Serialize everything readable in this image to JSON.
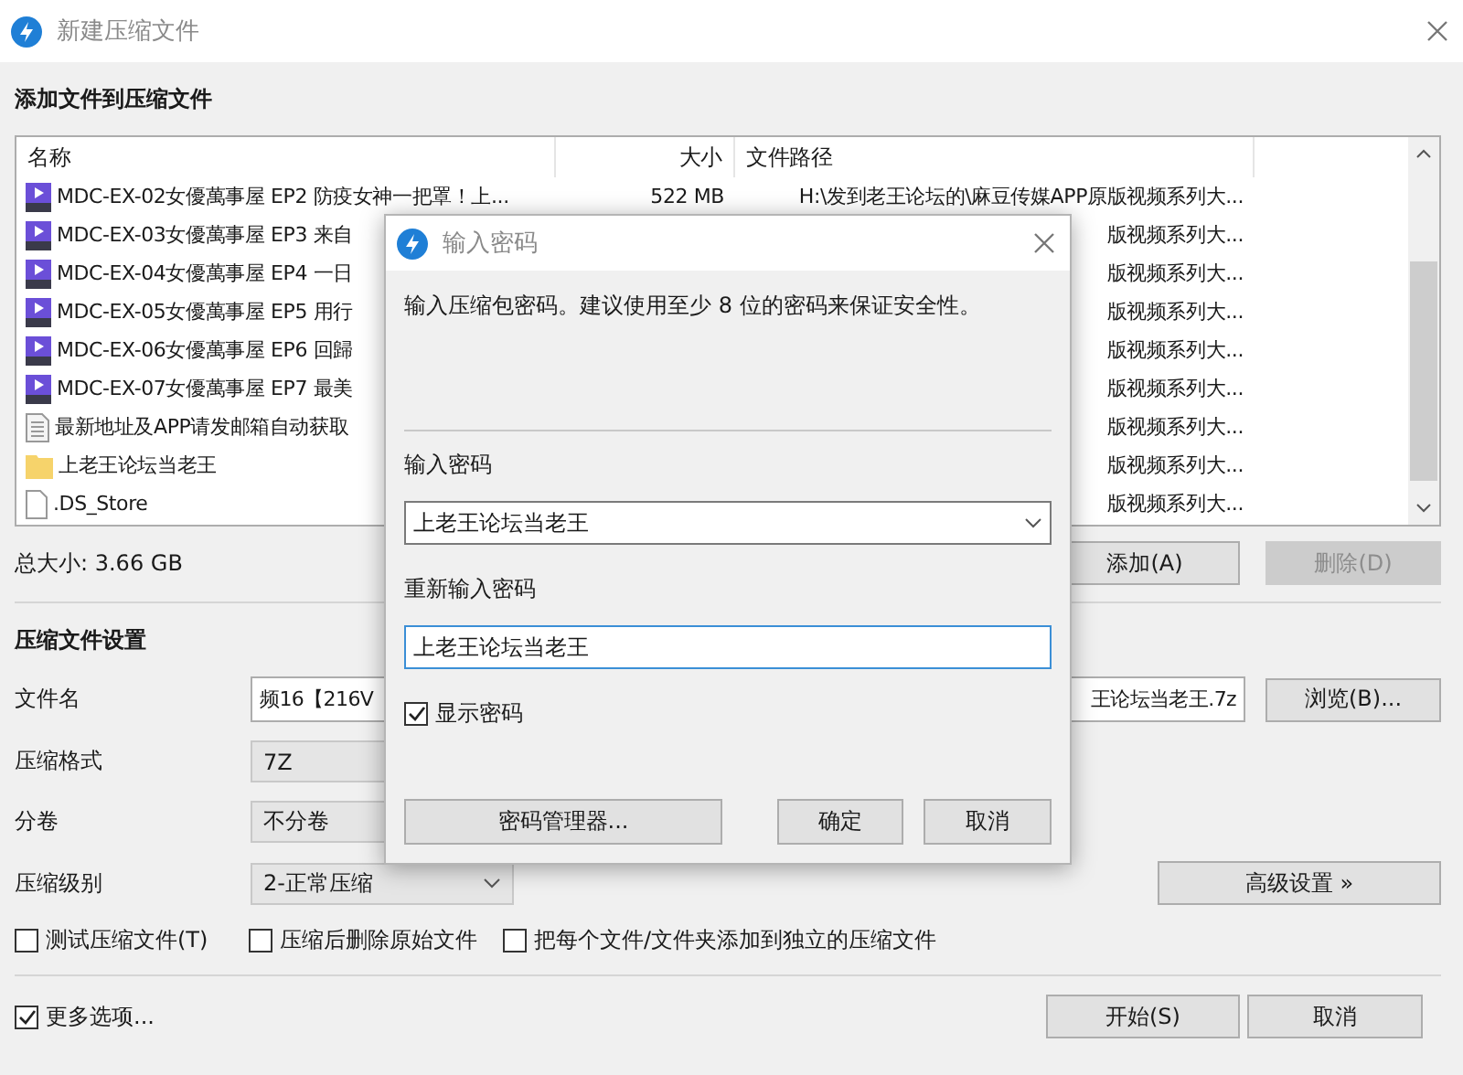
{
  "window": {
    "title": "新建压缩文件"
  },
  "files": {
    "heading": "添加文件到压缩文件",
    "columns": [
      "名称",
      "大小",
      "文件路径"
    ],
    "rows": [
      {
        "kind": "video",
        "name": "MDC-EX-02女優萬事屋 EP2 防疫女神一把罩！上...",
        "size": "522 MB",
        "path": "H:\\发到老王论坛的\\麻豆传媒APP原版视频系列大..."
      },
      {
        "kind": "video",
        "name": "MDC-EX-03女優萬事屋 EP3 来自",
        "path": "版视频系列大..."
      },
      {
        "kind": "video",
        "name": "MDC-EX-04女優萬事屋 EP4 一日",
        "path": "版视频系列大..."
      },
      {
        "kind": "video",
        "name": "MDC-EX-05女優萬事屋 EP5 用行",
        "path": "版视频系列大..."
      },
      {
        "kind": "video",
        "name": "MDC-EX-06女優萬事屋 EP6 回歸",
        "path": "版视频系列大..."
      },
      {
        "kind": "video",
        "name": "MDC-EX-07女優萬事屋 EP7 最美",
        "path": "版视频系列大..."
      },
      {
        "kind": "text",
        "name": "最新地址及APP请发邮箱自动获取",
        "path": "版视频系列大..."
      },
      {
        "kind": "folder",
        "name": "上老王论坛当老王",
        "path": "版视频系列大..."
      },
      {
        "kind": "file",
        "name": ".DS_Store",
        "path": "版视频系列大..."
      }
    ]
  },
  "total_size": "总大小: 3.66 GB",
  "file_buttons": [
    {
      "label": "添加(A)",
      "disabled": false
    },
    {
      "label": "删除(D)",
      "disabled": true
    }
  ],
  "settings": {
    "heading": "压缩文件设置",
    "filename": {
      "label": "文件名",
      "value_start": "频16【216V",
      "value_end": "王论坛当老王.7z"
    },
    "browse_button": "浏览(B)...",
    "selects": [
      {
        "kind": "box",
        "label": "压缩格式",
        "value": "7Z"
      },
      {
        "kind": "box",
        "label": "分卷",
        "value": "不分卷"
      },
      {
        "kind": "select",
        "label": "压缩级别",
        "value": "2-正常压缩"
      }
    ],
    "advanced_button": "高级设置 »",
    "options": [
      {
        "label": "测试压缩文件(T)",
        "checked": false
      },
      {
        "label": "压缩后删除原始文件",
        "checked": false
      },
      {
        "label": "把每个文件/文件夹添加到独立的压缩文件",
        "checked": false
      }
    ]
  },
  "more_options": {
    "label": "更多选项...",
    "checked": true
  },
  "footer_buttons": [
    "开始(S)",
    "取消"
  ],
  "password_dialog": {
    "title": "输入密码",
    "hint": "输入压缩包密码。建议使用至少 8 位的密码来保证安全性。",
    "password_label": "输入密码",
    "password_value": "上老王论坛当老王",
    "confirm_label": "重新输入密码",
    "confirm_value": "上老王论坛当老王",
    "show_password": {
      "label": "显示密码",
      "checked": true
    },
    "manager_button": "密码管理器...",
    "buttons": [
      "确定",
      "取消"
    ]
  }
}
